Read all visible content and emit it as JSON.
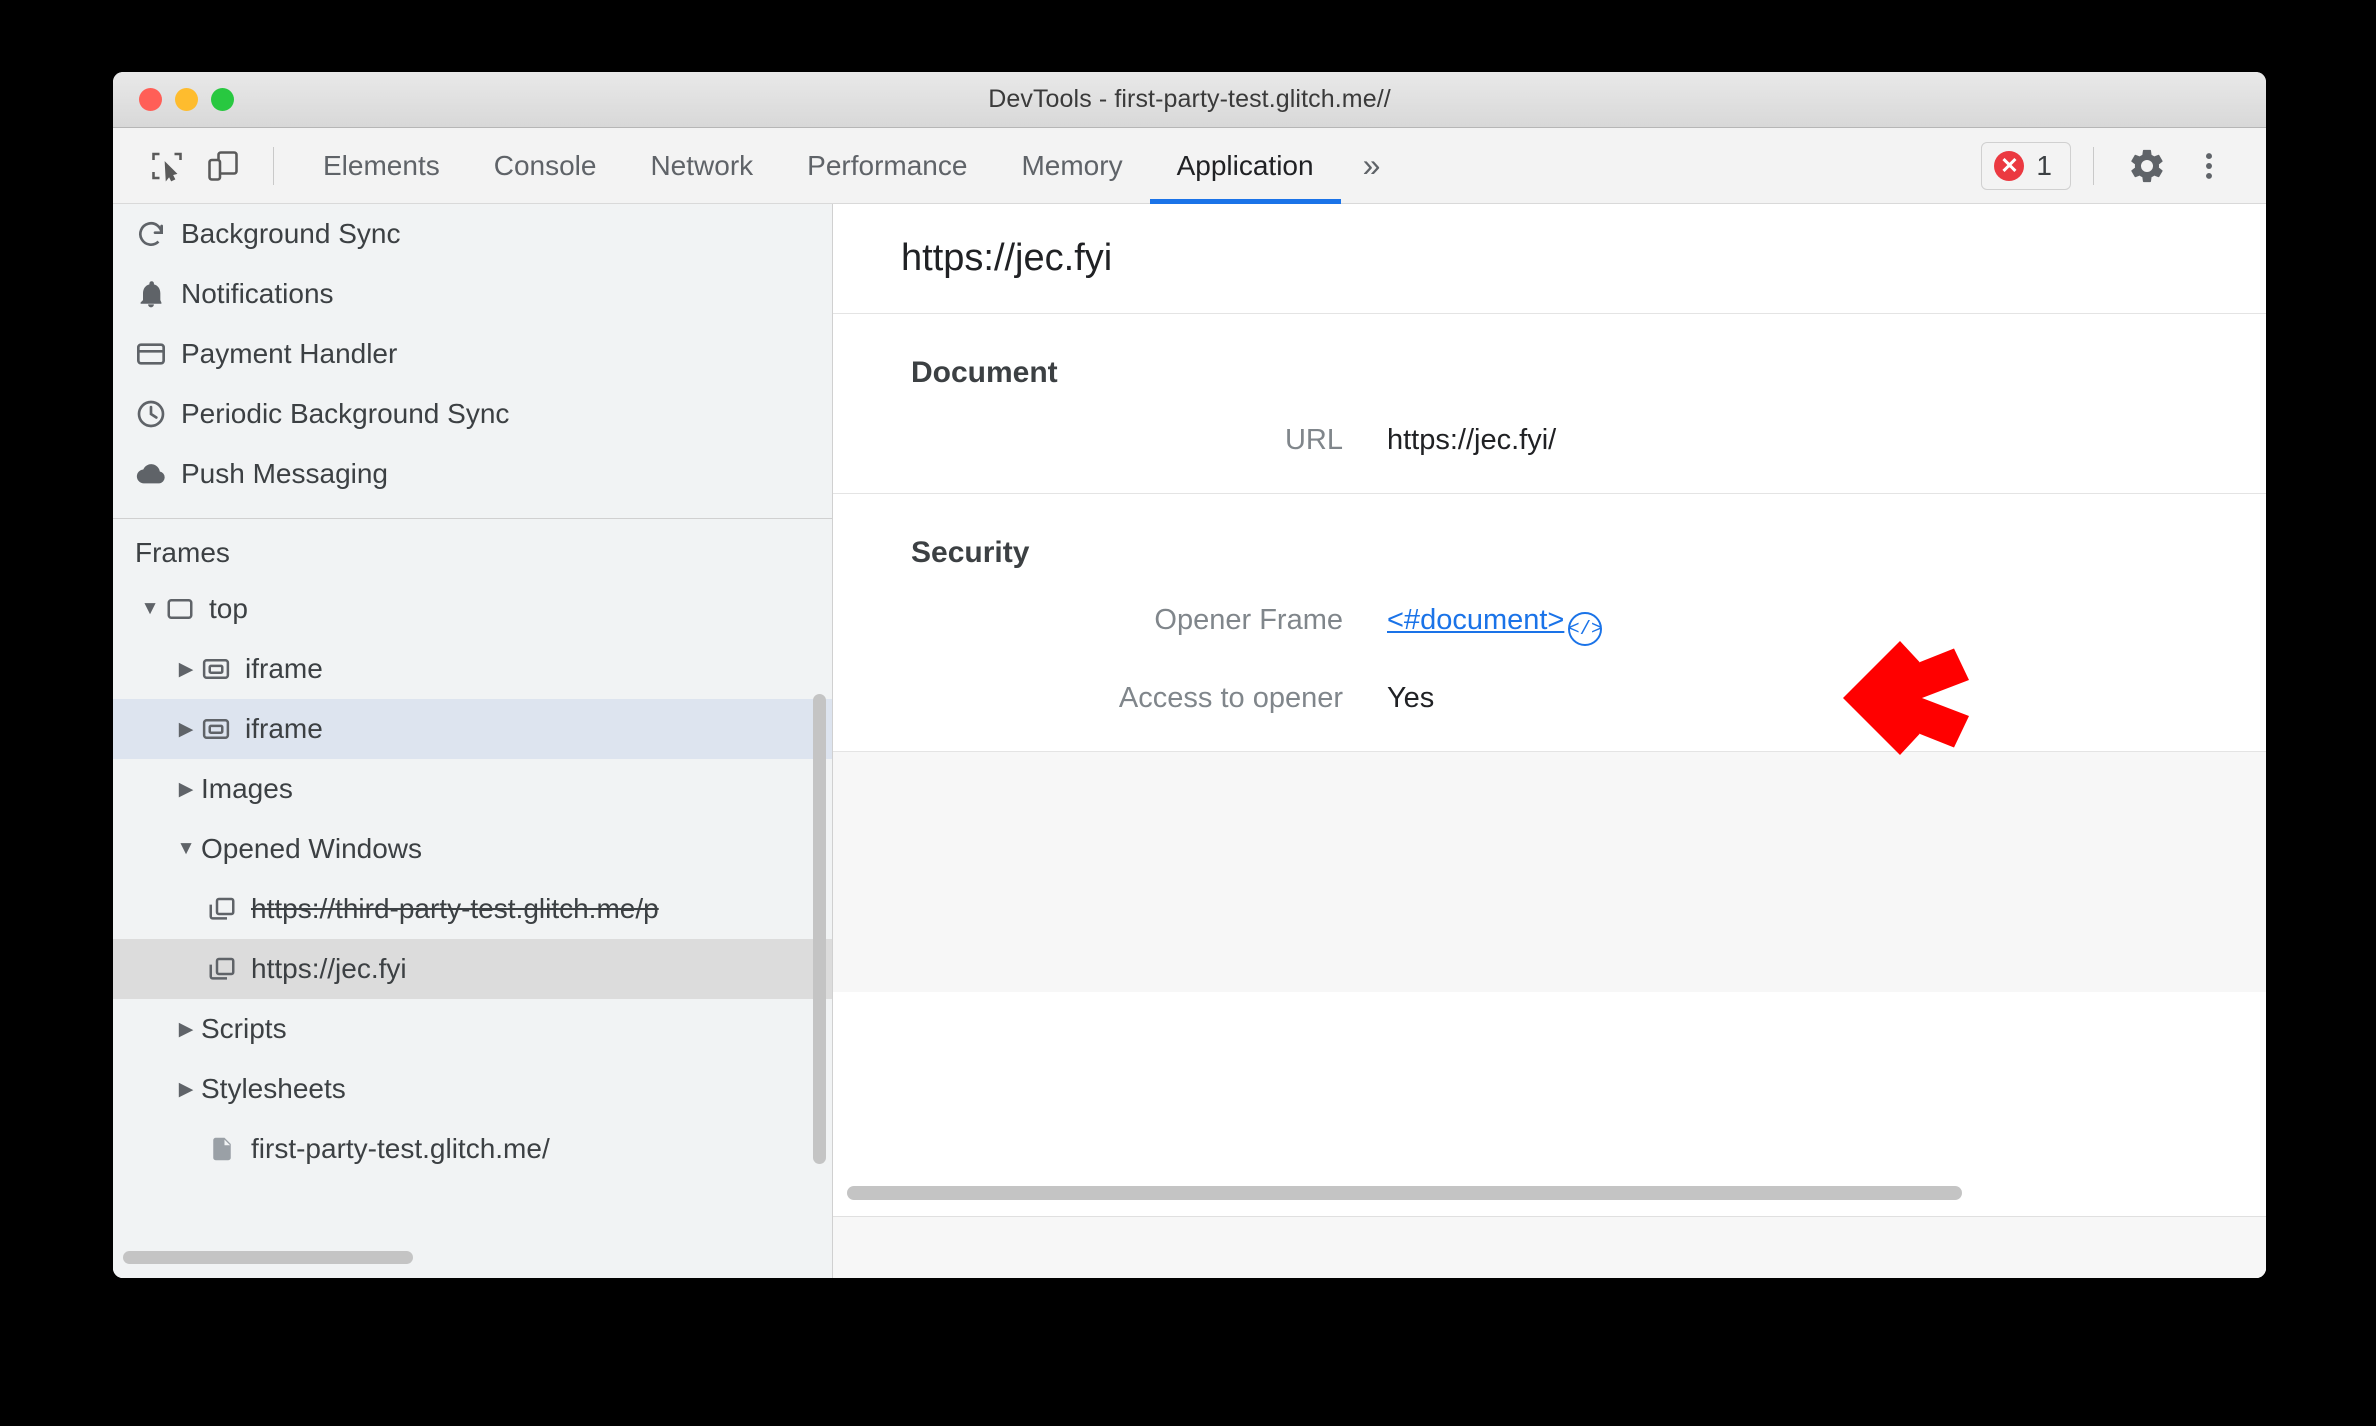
{
  "window": {
    "title": "DevTools - first-party-test.glitch.me//",
    "traffic_lights": [
      "close",
      "minimize",
      "zoom"
    ]
  },
  "toolbar": {
    "inspect_icon": "inspect-element-icon",
    "device_icon": "device-toolbar-icon",
    "tabs": [
      {
        "label": "Elements",
        "active": false
      },
      {
        "label": "Console",
        "active": false
      },
      {
        "label": "Network",
        "active": false
      },
      {
        "label": "Performance",
        "active": false
      },
      {
        "label": "Memory",
        "active": false
      },
      {
        "label": "Application",
        "active": true
      }
    ],
    "more_tabs_label": "»",
    "error_count": "1",
    "error_icon": "error-circle-icon",
    "settings_icon": "gear-icon",
    "menu_icon": "three-dot-menu-icon",
    "accent_color": "#1a73e8",
    "error_color": "#eb3941"
  },
  "sidebar": {
    "top_items": [
      {
        "label": "Background Sync",
        "icon": "sync-icon"
      },
      {
        "label": "Notifications",
        "icon": "bell-icon"
      },
      {
        "label": "Payment Handler",
        "icon": "credit-card-icon"
      },
      {
        "label": "Periodic Background Sync",
        "icon": "clock-icon"
      },
      {
        "label": "Push Messaging",
        "icon": "cloud-icon"
      }
    ],
    "frames_header": "Frames",
    "tree": [
      {
        "label": "top",
        "icon": "frame-icon",
        "arrow": "▼",
        "indent": 0,
        "selected": "none",
        "strike": false
      },
      {
        "label": "iframe",
        "icon": "iframe-icon",
        "arrow": "▶",
        "indent": 1,
        "selected": "none",
        "strike": false
      },
      {
        "label": "iframe",
        "icon": "iframe-icon",
        "arrow": "▶",
        "indent": 1,
        "selected": "blue",
        "strike": false
      },
      {
        "label": "Images",
        "icon": "none",
        "arrow": "▶",
        "indent": 1,
        "selected": "none",
        "strike": false
      },
      {
        "label": "Opened Windows",
        "icon": "none",
        "arrow": "▼",
        "indent": 1,
        "selected": "none",
        "strike": false
      },
      {
        "label": "https://third-party-test.glitch.me/p",
        "icon": "window-icon",
        "arrow": "none",
        "indent": 2,
        "selected": "none",
        "strike": true
      },
      {
        "label": "https://jec.fyi",
        "icon": "window-icon",
        "arrow": "none",
        "indent": 2,
        "selected": "gray",
        "strike": false
      },
      {
        "label": "Scripts",
        "icon": "none",
        "arrow": "▶",
        "indent": 1,
        "selected": "none",
        "strike": false
      },
      {
        "label": "Stylesheets",
        "icon": "none",
        "arrow": "▶",
        "indent": 1,
        "selected": "none",
        "strike": false
      },
      {
        "label": "first-party-test.glitch.me/",
        "icon": "document-icon",
        "arrow": "none",
        "indent": 2,
        "selected": "none",
        "strike": false
      }
    ]
  },
  "main": {
    "header_title": "https://jec.fyi",
    "sections": [
      {
        "title": "Document",
        "rows": [
          {
            "key": "URL",
            "value": "https://jec.fyi/",
            "type": "text"
          }
        ]
      },
      {
        "title": "Security",
        "rows": [
          {
            "key": "Opener Frame",
            "value": "<#document>",
            "type": "link",
            "badge": "</>"
          },
          {
            "key": "Access to opener",
            "value": "Yes",
            "type": "text"
          }
        ]
      }
    ]
  },
  "annotation": {
    "arrow_icon": "red-pointer-arrow",
    "color": "#ff0000",
    "points_at": "opener-frame-code-badge"
  }
}
